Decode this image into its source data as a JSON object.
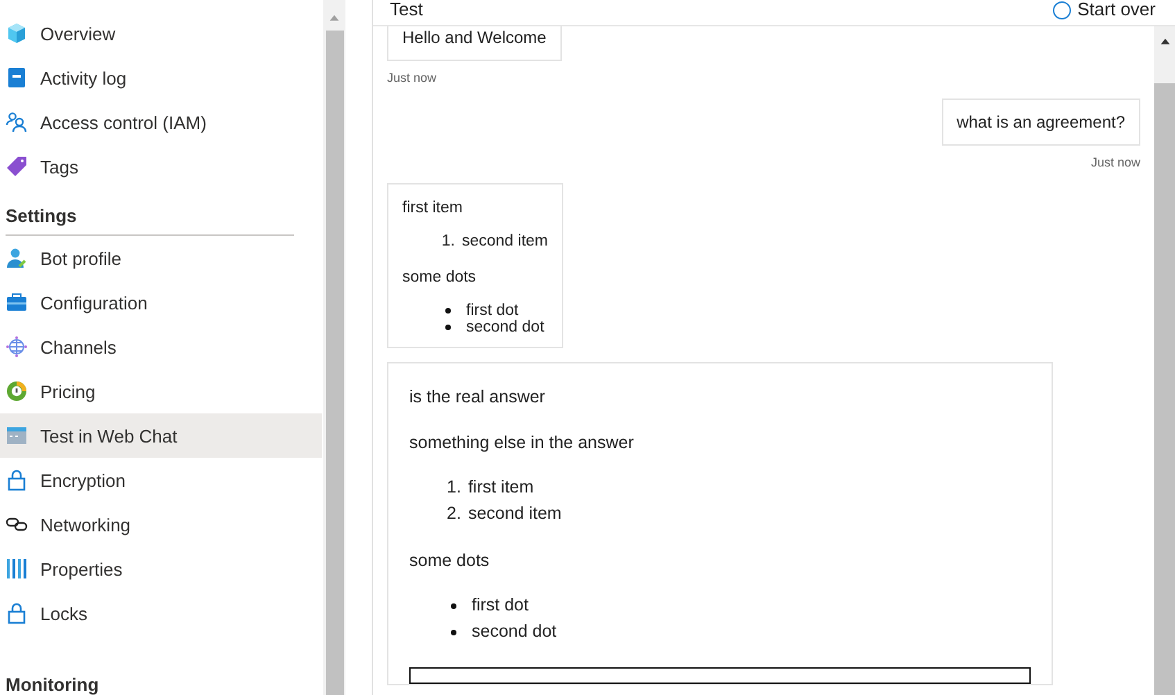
{
  "sidebar": {
    "sections": [
      {
        "items": [
          {
            "label": "Overview",
            "selected": false
          },
          {
            "label": "Activity log",
            "selected": false
          },
          {
            "label": "Access control (IAM)",
            "selected": false
          },
          {
            "label": "Tags",
            "selected": false
          }
        ]
      },
      {
        "heading": "Settings",
        "items": [
          {
            "label": "Bot profile",
            "selected": false
          },
          {
            "label": "Configuration",
            "selected": false
          },
          {
            "label": "Channels",
            "selected": false
          },
          {
            "label": "Pricing",
            "selected": false
          },
          {
            "label": "Test in Web Chat",
            "selected": true
          },
          {
            "label": "Encryption",
            "selected": false
          },
          {
            "label": "Networking",
            "selected": false
          },
          {
            "label": "Properties",
            "selected": false
          },
          {
            "label": "Locks",
            "selected": false
          }
        ]
      },
      {
        "heading": "Monitoring"
      }
    ]
  },
  "chat": {
    "title": "Test",
    "action": "Start over",
    "messages": [
      {
        "kind": "bot",
        "time": "Just now",
        "blocks": [
          {
            "kind": "paragraph",
            "text": "Hello and Welcome"
          }
        ]
      },
      {
        "kind": "user",
        "time": "Just now",
        "blocks": [
          {
            "kind": "paragraph",
            "text": "what is an agreement?"
          }
        ]
      },
      {
        "kind": "bot",
        "blocks": [
          {
            "kind": "paragraph",
            "text": "first item"
          },
          {
            "kind": "numbered",
            "items": [
              {
                "marker": "1.",
                "text": "second item"
              }
            ]
          },
          {
            "kind": "paragraph",
            "text": "some dots"
          },
          {
            "kind": "bulleted",
            "items": [
              {
                "text": "first dot"
              },
              {
                "text": "second dot"
              }
            ]
          }
        ]
      },
      {
        "kind": "answer",
        "blocks": [
          {
            "kind": "paragraph",
            "text": "is the real answer"
          },
          {
            "kind": "paragraph",
            "text": "something else in the answer"
          },
          {
            "kind": "numbered",
            "items": [
              {
                "marker": "1.",
                "text": "first item"
              },
              {
                "marker": "2.",
                "text": "second item"
              }
            ]
          },
          {
            "kind": "paragraph",
            "text": "some dots"
          },
          {
            "kind": "bulleted",
            "items": [
              {
                "text": "first dot"
              },
              {
                "text": "second dot"
              }
            ]
          },
          {
            "kind": "box"
          }
        ]
      }
    ]
  }
}
